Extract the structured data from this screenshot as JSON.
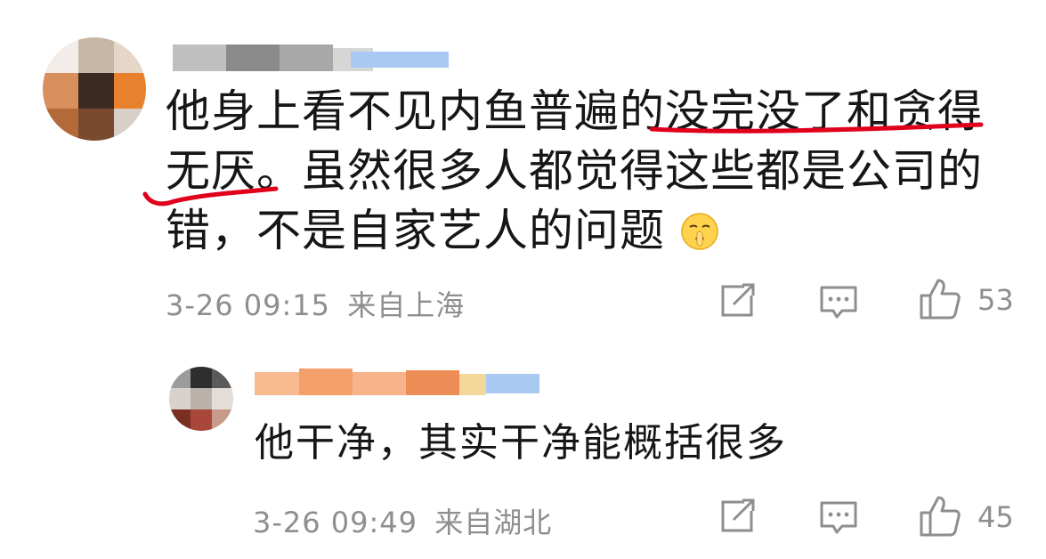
{
  "comments": [
    {
      "text_line1": "他身上看不见内鱼普遍的没完没了和贪得",
      "text_line2": "无厌。虽然很多人都觉得这些都是公司的",
      "text_line3": "错，不是自家艺人的问题",
      "emoji": "shush-face-icon",
      "time": "3-26 09:15",
      "location": "来自上海",
      "likes": "53"
    },
    {
      "text": "他干净，其实干净能概括很多",
      "time": "3-26 09:49",
      "location": "来自湖北",
      "likes": "45"
    }
  ],
  "colors": {
    "text": "#161616",
    "meta": "#8e8e8e",
    "underline": "#e0001b"
  }
}
